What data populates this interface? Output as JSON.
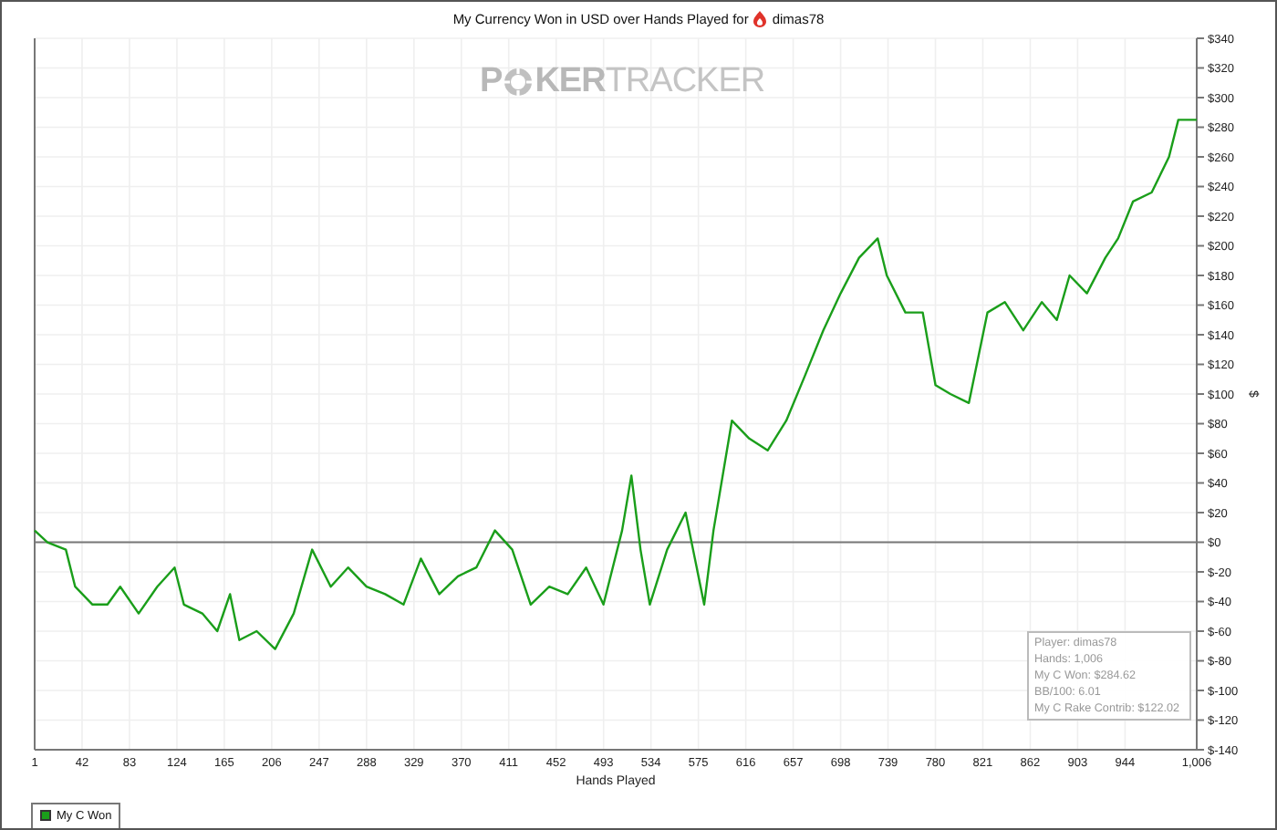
{
  "chart": {
    "title": "My Currency Won in USD over Hands Played for",
    "player": "dimas78",
    "logo": [
      "P",
      "KER",
      "TRACKER"
    ],
    "chart_data": {
      "type": "line",
      "xlabel": "Hands Played",
      "ylabel": "$",
      "x": [
        1,
        12,
        28,
        36,
        51,
        64,
        75,
        91,
        107,
        122,
        130,
        146,
        159,
        170,
        178,
        193,
        209,
        225,
        241,
        257,
        272,
        288,
        304,
        320,
        335,
        351,
        367,
        383,
        399,
        414,
        430,
        446,
        462,
        478,
        493,
        509,
        517,
        525,
        533,
        548,
        564,
        580,
        588,
        604,
        619,
        635,
        651,
        667,
        683,
        698,
        714,
        730,
        738,
        754,
        769,
        780,
        793,
        809,
        825,
        840,
        856,
        872,
        885,
        896,
        911,
        927,
        938,
        951,
        967,
        982,
        990,
        1006
      ],
      "series": [
        {
          "name": "My C Won",
          "color": "#1a9e1a",
          "values": [
            8,
            0,
            -5,
            -30,
            -42,
            -42,
            -30,
            -48,
            -30,
            -17,
            -42,
            -48,
            -60,
            -35,
            -66,
            -60,
            -72,
            -48,
            -5,
            -30,
            -17,
            -30,
            -35,
            -42,
            -11,
            -35,
            -23,
            -17,
            8,
            -5,
            -42,
            -30,
            -35,
            -17,
            -42,
            8,
            45,
            -5,
            -42,
            -5,
            20,
            -42,
            8,
            82,
            70,
            62,
            82,
            112,
            143,
            168,
            192,
            205,
            180,
            155,
            155,
            106,
            100,
            94,
            155,
            162,
            143,
            162,
            150,
            180,
            168,
            192,
            205,
            230,
            236,
            260,
            285,
            285
          ]
        }
      ],
      "grid": true,
      "xlim": [
        1,
        1006
      ],
      "ylim": [
        -140,
        340
      ],
      "xticks": [
        1,
        42,
        83,
        124,
        165,
        206,
        247,
        288,
        329,
        370,
        411,
        452,
        493,
        534,
        575,
        616,
        657,
        698,
        739,
        780,
        821,
        862,
        903,
        944,
        {
          "value": 1006,
          "label": "1,006"
        }
      ],
      "yticks": [
        {
          "value": -140,
          "label": "$-140"
        },
        {
          "value": -120,
          "label": "$-120"
        },
        {
          "value": -100,
          "label": "$-100"
        },
        {
          "value": -80,
          "label": "$-80"
        },
        {
          "value": -60,
          "label": "$-60"
        },
        {
          "value": -40,
          "label": "$-40"
        },
        {
          "value": -20,
          "label": "$-20"
        },
        {
          "value": 0,
          "label": "$0"
        },
        {
          "value": 20,
          "label": "$20"
        },
        {
          "value": 40,
          "label": "$40"
        },
        {
          "value": 60,
          "label": "$60"
        },
        {
          "value": 80,
          "label": "$80"
        },
        {
          "value": 100,
          "label": "$100"
        },
        {
          "value": 120,
          "label": "$120"
        },
        {
          "value": 140,
          "label": "$140"
        },
        {
          "value": 160,
          "label": "$160"
        },
        {
          "value": 180,
          "label": "$180"
        },
        {
          "value": 200,
          "label": "$200"
        },
        {
          "value": 220,
          "label": "$220"
        },
        {
          "value": 240,
          "label": "$240"
        },
        {
          "value": 260,
          "label": "$260"
        },
        {
          "value": 280,
          "label": "$280"
        },
        {
          "value": 300,
          "label": "$300"
        },
        {
          "value": 320,
          "label": "$320"
        },
        {
          "value": 340,
          "label": "$340"
        }
      ]
    },
    "tooltip": [
      "Player: dimas78",
      "Hands: 1,006",
      "My C Won: $284.62",
      "BB/100: 6.01",
      "My C Rake Contrib: $122.02"
    ]
  }
}
